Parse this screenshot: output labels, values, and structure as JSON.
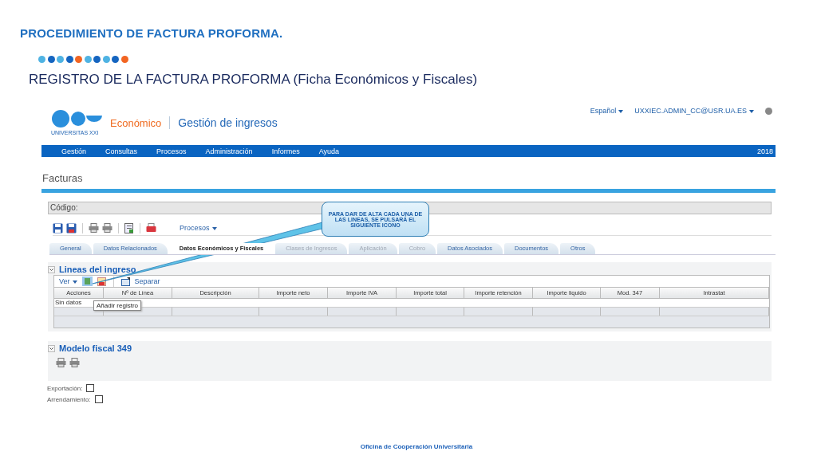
{
  "slide": {
    "title": "PROCEDIMIENTO DE FACTURA PROFORMA.",
    "dots": [
      {
        "color": "#4fb3e3"
      },
      {
        "color": "#1565c0"
      },
      {
        "color": "#4fb3e3"
      },
      {
        "color": "#1565c0"
      },
      {
        "color": "#f26522"
      },
      {
        "color": "#4fb3e3"
      },
      {
        "color": "#1565c0"
      },
      {
        "color": "#4fb3e3"
      },
      {
        "color": "#1565c0"
      },
      {
        "color": "#f26522"
      }
    ],
    "subtitle": "REGISTRO DE LA FACTURA PROFORMA (Ficha Económicos y Fiscales)"
  },
  "app": {
    "brand": "UNIVERSITAS XXI",
    "module": "Económico",
    "app_title": "Gestión de ingresos",
    "language": "Español",
    "user": "UXXIEC.ADMIN_CC@USR.UA.ES",
    "menu": [
      "Gestión",
      "Consultas",
      "Procesos",
      "Administración",
      "Informes",
      "Ayuda"
    ],
    "year": "2018",
    "page_title": "Facturas",
    "code_label": "Código:",
    "toolbar_menu": "Procesos",
    "tabs": [
      {
        "label": "General",
        "selected": false,
        "disabled": false
      },
      {
        "label": "Datos Relacionados",
        "selected": false,
        "disabled": false
      },
      {
        "label": "Datos Económicos y Fiscales",
        "selected": true,
        "disabled": false
      },
      {
        "label": "Clases de Ingresos",
        "selected": false,
        "disabled": true
      },
      {
        "label": "Aplicación",
        "selected": false,
        "disabled": true
      },
      {
        "label": "Cobro",
        "selected": false,
        "disabled": true
      },
      {
        "label": "Datos Asociados",
        "selected": false,
        "disabled": false
      },
      {
        "label": "Documentos",
        "selected": false,
        "disabled": false
      },
      {
        "label": "Otros",
        "selected": false,
        "disabled": false
      }
    ],
    "lines_section": {
      "title": "Lineas del ingreso",
      "expanded": true,
      "view_menu": "Ver",
      "split_button": "Separar",
      "tooltip": "Añadir registro",
      "columns": [
        "Acciones",
        "Nº de Línea",
        "Descripción",
        "Importe neto",
        "Importe IVA",
        "Importe total",
        "Importe retención",
        "Importe liquido",
        "Mod. 347",
        "Intrastat"
      ],
      "empty_text": "Sin datos"
    },
    "fiscal_section": {
      "title": "Modelo fiscal 349",
      "expanded": true
    },
    "checkboxes": [
      {
        "label": "Exportación:",
        "checked": false
      },
      {
        "label": "Arrendamiento:",
        "checked": false
      }
    ]
  },
  "callout": {
    "text": "PARA DAR DE ALTA CADA UNA DE LAS LINEAS, SE PULSARÁ EL SIGUIENTE ICONO"
  },
  "footer": "Oficina de Cooperación Universitaria"
}
